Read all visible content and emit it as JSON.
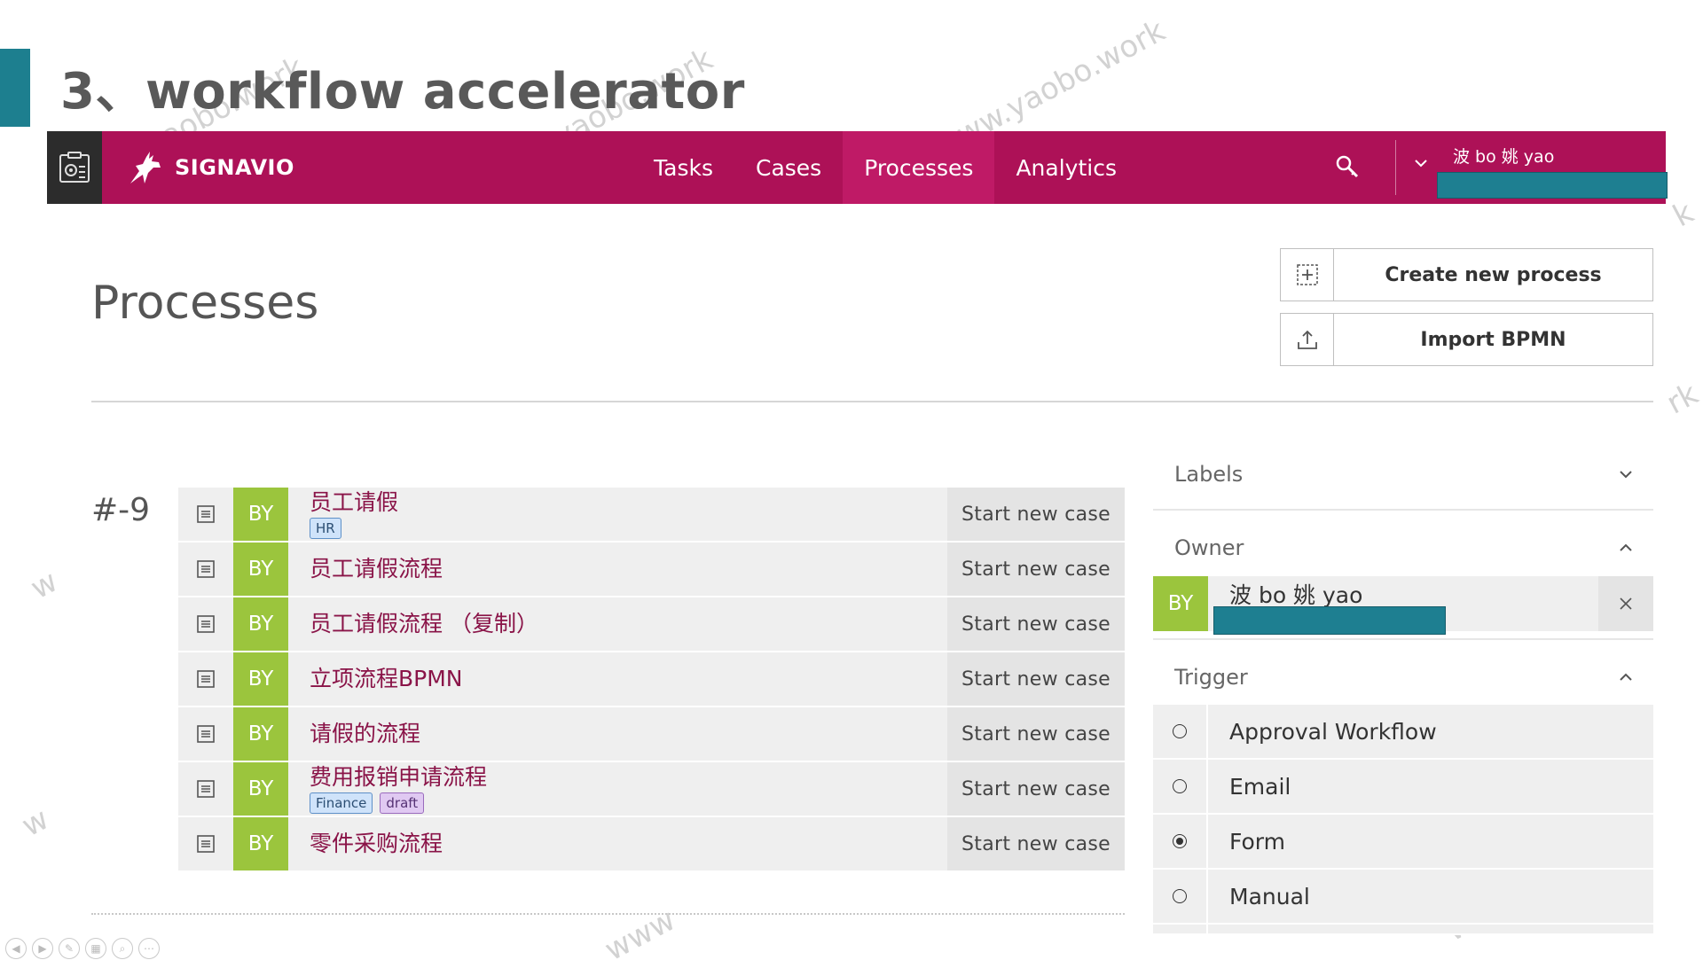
{
  "slide": {
    "title": "3、workflow accelerator",
    "watermarks": [
      "www.yaobo.work",
      "yaobo.work",
      "www.yaobo.work",
      "rk",
      "k",
      "w",
      "w",
      "W",
      "www"
    ]
  },
  "navbar": {
    "brand": "SIGNAVIO",
    "links": [
      {
        "label": "Tasks",
        "active": false
      },
      {
        "label": "Cases",
        "active": false
      },
      {
        "label": "Processes",
        "active": true
      },
      {
        "label": "Analytics",
        "active": false
      }
    ],
    "user_name": "波 bo 姚 yao",
    "color": "#ad1157"
  },
  "page": {
    "title": "Processes",
    "create_label": "Create new process",
    "import_label": "Import BPMN"
  },
  "process_list": {
    "count": "#-9",
    "start_label": "Start new case",
    "avatar": "BY",
    "rows": [
      {
        "name": "员工请假",
        "tags": [
          "HR"
        ]
      },
      {
        "name": "员工请假流程",
        "tags": []
      },
      {
        "name": "员工请假流程 （复制）",
        "tags": []
      },
      {
        "name": "立项流程BPMN",
        "tags": []
      },
      {
        "name": "请假的流程",
        "tags": []
      },
      {
        "name": "费用报销申请流程",
        "tags": [
          "Finance",
          "draft"
        ]
      },
      {
        "name": "零件采购流程",
        "tags": []
      }
    ]
  },
  "filters": {
    "labels": {
      "title": "Labels",
      "expanded": false
    },
    "owner": {
      "title": "Owner",
      "expanded": true,
      "avatar": "BY",
      "name": "波 bo 姚 yao"
    },
    "trigger": {
      "title": "Trigger",
      "expanded": true,
      "options": [
        {
          "label": "Approval Workflow",
          "selected": false
        },
        {
          "label": "Email",
          "selected": false
        },
        {
          "label": "Form",
          "selected": true
        },
        {
          "label": "Manual",
          "selected": false
        }
      ]
    }
  },
  "icons": {
    "app": "workflow-gear-icon",
    "logo": "antelope-logo-icon",
    "search": "search-icon",
    "chevron": "chevron-down-icon",
    "create": "add-square-icon",
    "import": "upload-icon",
    "document": "document-list-icon",
    "close": "close-icon"
  }
}
